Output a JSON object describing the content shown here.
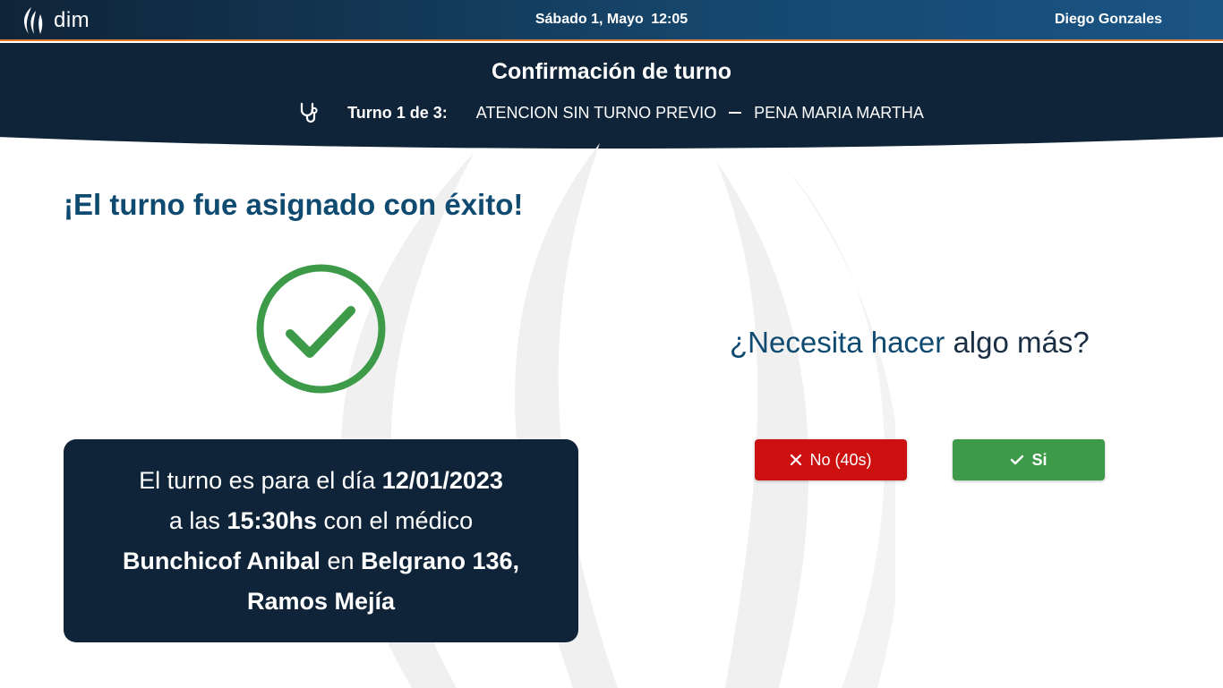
{
  "topbar": {
    "logo_text": "dim",
    "date": "Sábado 1, Mayo",
    "time": "12:05",
    "user": "Diego Gonzales"
  },
  "header": {
    "title": "Confirmación de turno",
    "turno_label": "Turno 1 de 3:",
    "service": "ATENCION SIN TURNO PREVIO",
    "doctor": "PENA MARIA MARTHA"
  },
  "main": {
    "success_title": "¡El turno fue asignado con éxito!",
    "info": {
      "t1": "El turno es para el día ",
      "date": "12/01/2023",
      "t2": "a las ",
      "time": "15:30hs",
      "t3": " con el médico",
      "doctor": "Bunchicof Anibal",
      "t4": " en ",
      "address": "Belgrano 136, Ramos Mejía"
    },
    "question": {
      "part1": "¿Necesita hacer ",
      "part2": "algo más?"
    },
    "buttons": {
      "no_label": "No (40s)",
      "si_label": "Si"
    }
  },
  "colors": {
    "primary_dark": "#0f2438",
    "accent_blue": "#0f4a70",
    "success_green": "#3d9a48",
    "danger_red": "#cc1010",
    "orange_line": "#e07a2a"
  },
  "icons": {
    "logo": "flame-logo-icon",
    "stethoscope": "stethoscope-icon",
    "success": "check-circle-icon",
    "no": "close-icon",
    "si": "check-icon"
  }
}
